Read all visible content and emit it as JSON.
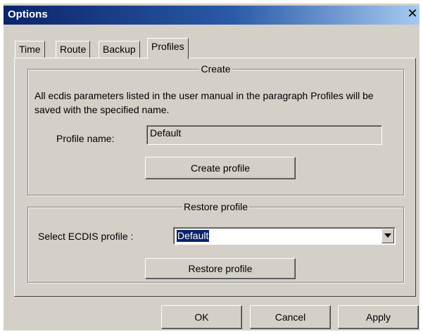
{
  "window": {
    "title": "Options",
    "close_glyph": "✕"
  },
  "tabs": [
    {
      "label": "Time",
      "active": false
    },
    {
      "label": "Route",
      "active": false
    },
    {
      "label": "Backup",
      "active": false
    },
    {
      "label": "Profiles",
      "active": true
    }
  ],
  "create": {
    "group_title": "Create",
    "description": "All ecdis parameters listed in the user manual in the paragraph Profiles will be saved with the specified name.",
    "profile_name_label": "Profile name:",
    "profile_name_value": "Default",
    "create_button": "Create profile"
  },
  "restore": {
    "group_title": "Restore profile",
    "select_label": "Select ECDIS profile :",
    "selected_value": "Default",
    "restore_button": "Restore profile"
  },
  "footer": {
    "ok": "OK",
    "cancel": "Cancel",
    "apply": "Apply"
  },
  "colors": {
    "dialog_face": "#d4d0c8",
    "title_bar": "#0a246a",
    "selection": "#0a246a"
  },
  "icons": {
    "close": "close-icon",
    "dropdown": "chevron-down-icon"
  }
}
